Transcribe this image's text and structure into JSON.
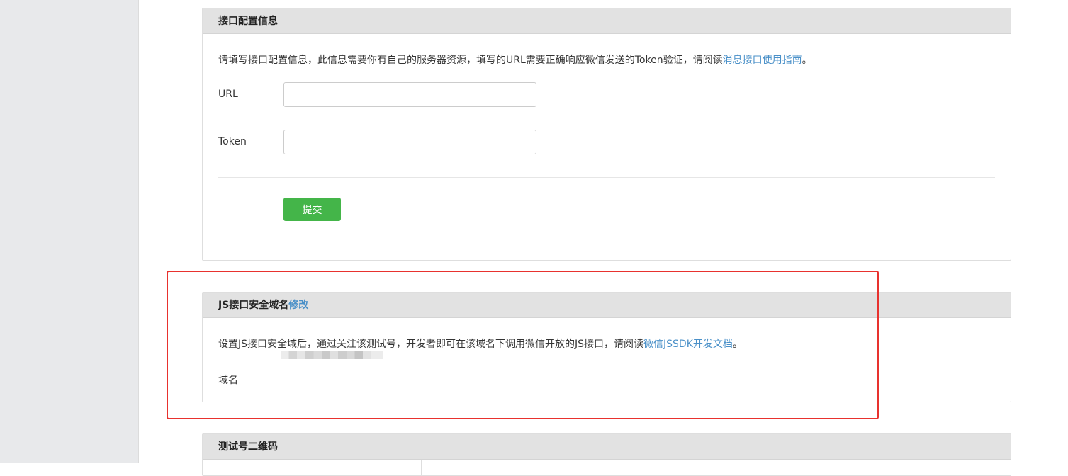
{
  "panels": {
    "interface_config": {
      "title": "接口配置信息",
      "desc_text": "请填写接口配置信息，此信息需要你有自己的服务器资源，填写的URL需要正确响应微信发送的Token验证，请阅读",
      "desc_link": "消息接口使用指南",
      "desc_end": "。",
      "url_label": "URL",
      "url_value": "",
      "token_label": "Token",
      "token_value": "",
      "submit_label": "提交"
    },
    "js_domain": {
      "title": "JS接口安全域名",
      "title_link": "修改",
      "desc_text": "设置JS接口安全域后，通过关注该测试号，开发者即可在该域名下调用微信开放的JS接口，请阅读",
      "desc_link": "微信JSSDK开发文档",
      "desc_end": "。",
      "domain_label": "域名"
    },
    "qr_code": {
      "title": "测试号二维码"
    }
  },
  "colors": {
    "accent_link": "#4a90c8",
    "submit_green": "#44b549",
    "highlight_red": "#e8322e"
  }
}
